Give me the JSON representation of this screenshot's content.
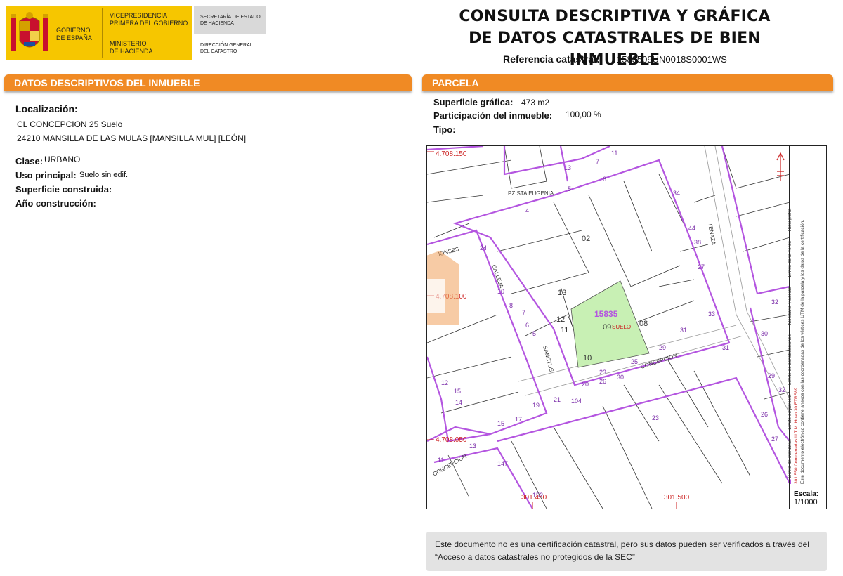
{
  "header": {
    "gov_name": "GOBIERNO\nDE ESPAÑA",
    "vicepresidencia": "VICEPRESIDENCIA\nPRIMERA DEL GOBIERNO",
    "ministerio": "MINISTERIO\nDE HACIENDA",
    "secretaria": "SECRETARÍA DE ESTADO\nDE HACIENDA",
    "direccion": "DIRECCIÓN GENERAL\nDEL CATASTRO",
    "title_line1": "CONSULTA DESCRIPTIVA Y GRÁFICA",
    "title_line2": "DE DATOS CATASTRALES DE BIEN INMUEBLE",
    "ref_label": "Referencia catastral:",
    "ref_value": "1583509UN0018S0001WS"
  },
  "left": {
    "section_title": "DATOS DESCRIPTIVOS DEL INMUEBLE",
    "localizacion_label": "Localización:",
    "address_line1": "CL CONCEPCION 25 Suelo",
    "address_line2": "24210 MANSILLA DE LAS MULAS [MANSILLA MUL] [LEÓN]",
    "clase_label": "Clase:",
    "clase_value": "URBANO",
    "uso_label": "Uso principal:",
    "uso_value": "Suelo sin edif.",
    "superficie_label": "Superficie construida:",
    "anio_label": "Año construcción:"
  },
  "right": {
    "section_title": "PARCELA",
    "sup_grafica_label": "Superficie gráfica:",
    "sup_grafica_value": "473 m2",
    "participacion_label": "Participación del inmueble:",
    "participacion_value": "100,00 %",
    "tipo_label": "Tipo:"
  },
  "map": {
    "coord_y1": "4.708.150",
    "coord_y2": "4.708.100",
    "coord_y3": "4.708.050",
    "coord_x1": "301.450",
    "coord_x2": "301.500",
    "parcel_id": "15835",
    "parcel_num": "09",
    "suelo": "SUELO",
    "street_eugenia": "PZ STA EUGENIA",
    "street_concepcion": "CONCEPCION",
    "street_tenaza": "TENAZA",
    "street_calle": "CALLEJA",
    "street_jonses": "JONSES",
    "street_sanctus": "SANCTUS",
    "street_conmelon": "CONCEPCION",
    "escala_label": "Escala:",
    "escala_value": "1/1000",
    "legend1": "Límite de manzana",
    "legend2": "Límite de parcela",
    "legend3": "Límite de construcciones",
    "legend4": "Mobiliario y aceras",
    "legend5": "Límite zona verde",
    "legend6": "Hidrografía",
    "coords_text": "301.550 Coordenadas U.T.M. Huso 30 ETRS89",
    "doc_text": "Este documento electrónico contiene anexos con las coordenadas de los vértices UTM de la parcela y los datos de la certificación."
  },
  "note": {
    "text": "Este documento no es una certificación catastral, pero sus datos pueden ser verificados a través del “Acceso a datos catastrales no protegidos de la SEC”"
  },
  "colors": {
    "gov_yellow": "#f6c600",
    "section_orange": "#f08a24",
    "block_purple": "#b455e0",
    "parcel_green": "#c8f0b4",
    "coord_red": "#cc2222"
  }
}
